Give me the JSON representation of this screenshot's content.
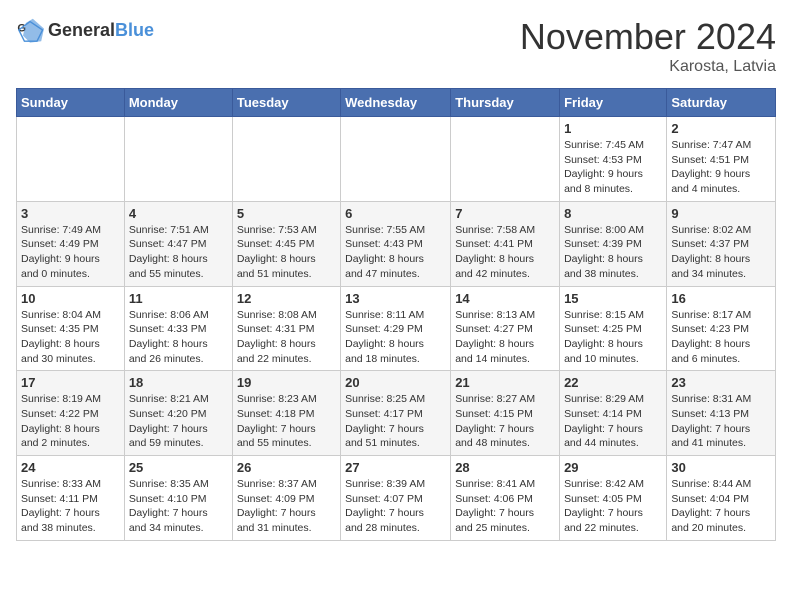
{
  "header": {
    "logo_general": "General",
    "logo_blue": "Blue",
    "month": "November 2024",
    "location": "Karosta, Latvia"
  },
  "weekdays": [
    "Sunday",
    "Monday",
    "Tuesday",
    "Wednesday",
    "Thursday",
    "Friday",
    "Saturday"
  ],
  "weeks": [
    [
      {
        "day": "",
        "detail": ""
      },
      {
        "day": "",
        "detail": ""
      },
      {
        "day": "",
        "detail": ""
      },
      {
        "day": "",
        "detail": ""
      },
      {
        "day": "",
        "detail": ""
      },
      {
        "day": "1",
        "detail": "Sunrise: 7:45 AM\nSunset: 4:53 PM\nDaylight: 9 hours\nand 8 minutes."
      },
      {
        "day": "2",
        "detail": "Sunrise: 7:47 AM\nSunset: 4:51 PM\nDaylight: 9 hours\nand 4 minutes."
      }
    ],
    [
      {
        "day": "3",
        "detail": "Sunrise: 7:49 AM\nSunset: 4:49 PM\nDaylight: 9 hours\nand 0 minutes."
      },
      {
        "day": "4",
        "detail": "Sunrise: 7:51 AM\nSunset: 4:47 PM\nDaylight: 8 hours\nand 55 minutes."
      },
      {
        "day": "5",
        "detail": "Sunrise: 7:53 AM\nSunset: 4:45 PM\nDaylight: 8 hours\nand 51 minutes."
      },
      {
        "day": "6",
        "detail": "Sunrise: 7:55 AM\nSunset: 4:43 PM\nDaylight: 8 hours\nand 47 minutes."
      },
      {
        "day": "7",
        "detail": "Sunrise: 7:58 AM\nSunset: 4:41 PM\nDaylight: 8 hours\nand 42 minutes."
      },
      {
        "day": "8",
        "detail": "Sunrise: 8:00 AM\nSunset: 4:39 PM\nDaylight: 8 hours\nand 38 minutes."
      },
      {
        "day": "9",
        "detail": "Sunrise: 8:02 AM\nSunset: 4:37 PM\nDaylight: 8 hours\nand 34 minutes."
      }
    ],
    [
      {
        "day": "10",
        "detail": "Sunrise: 8:04 AM\nSunset: 4:35 PM\nDaylight: 8 hours\nand 30 minutes."
      },
      {
        "day": "11",
        "detail": "Sunrise: 8:06 AM\nSunset: 4:33 PM\nDaylight: 8 hours\nand 26 minutes."
      },
      {
        "day": "12",
        "detail": "Sunrise: 8:08 AM\nSunset: 4:31 PM\nDaylight: 8 hours\nand 22 minutes."
      },
      {
        "day": "13",
        "detail": "Sunrise: 8:11 AM\nSunset: 4:29 PM\nDaylight: 8 hours\nand 18 minutes."
      },
      {
        "day": "14",
        "detail": "Sunrise: 8:13 AM\nSunset: 4:27 PM\nDaylight: 8 hours\nand 14 minutes."
      },
      {
        "day": "15",
        "detail": "Sunrise: 8:15 AM\nSunset: 4:25 PM\nDaylight: 8 hours\nand 10 minutes."
      },
      {
        "day": "16",
        "detail": "Sunrise: 8:17 AM\nSunset: 4:23 PM\nDaylight: 8 hours\nand 6 minutes."
      }
    ],
    [
      {
        "day": "17",
        "detail": "Sunrise: 8:19 AM\nSunset: 4:22 PM\nDaylight: 8 hours\nand 2 minutes."
      },
      {
        "day": "18",
        "detail": "Sunrise: 8:21 AM\nSunset: 4:20 PM\nDaylight: 7 hours\nand 59 minutes."
      },
      {
        "day": "19",
        "detail": "Sunrise: 8:23 AM\nSunset: 4:18 PM\nDaylight: 7 hours\nand 55 minutes."
      },
      {
        "day": "20",
        "detail": "Sunrise: 8:25 AM\nSunset: 4:17 PM\nDaylight: 7 hours\nand 51 minutes."
      },
      {
        "day": "21",
        "detail": "Sunrise: 8:27 AM\nSunset: 4:15 PM\nDaylight: 7 hours\nand 48 minutes."
      },
      {
        "day": "22",
        "detail": "Sunrise: 8:29 AM\nSunset: 4:14 PM\nDaylight: 7 hours\nand 44 minutes."
      },
      {
        "day": "23",
        "detail": "Sunrise: 8:31 AM\nSunset: 4:13 PM\nDaylight: 7 hours\nand 41 minutes."
      }
    ],
    [
      {
        "day": "24",
        "detail": "Sunrise: 8:33 AM\nSunset: 4:11 PM\nDaylight: 7 hours\nand 38 minutes."
      },
      {
        "day": "25",
        "detail": "Sunrise: 8:35 AM\nSunset: 4:10 PM\nDaylight: 7 hours\nand 34 minutes."
      },
      {
        "day": "26",
        "detail": "Sunrise: 8:37 AM\nSunset: 4:09 PM\nDaylight: 7 hours\nand 31 minutes."
      },
      {
        "day": "27",
        "detail": "Sunrise: 8:39 AM\nSunset: 4:07 PM\nDaylight: 7 hours\nand 28 minutes."
      },
      {
        "day": "28",
        "detail": "Sunrise: 8:41 AM\nSunset: 4:06 PM\nDaylight: 7 hours\nand 25 minutes."
      },
      {
        "day": "29",
        "detail": "Sunrise: 8:42 AM\nSunset: 4:05 PM\nDaylight: 7 hours\nand 22 minutes."
      },
      {
        "day": "30",
        "detail": "Sunrise: 8:44 AM\nSunset: 4:04 PM\nDaylight: 7 hours\nand 20 minutes."
      }
    ]
  ]
}
